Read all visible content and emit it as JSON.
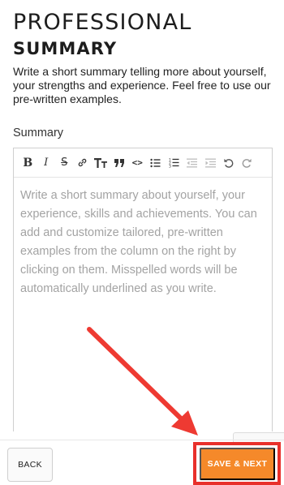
{
  "heading": {
    "line1": "PROFESSIONAL",
    "line2": "SUMMARY"
  },
  "description": "Write a short summary telling more about yourself, your strengths and experience. Feel free to use our pre-written examples.",
  "field": {
    "label": "Summary",
    "placeholder": "Write a short summary about yourself, your experience, skills and achievements. You can add and customize tailored, pre-written examples from the column on the right by clicking on them. Misspelled words will be automatically underlined as you write."
  },
  "toolbar": {
    "bold": "B",
    "italic": "I",
    "strike": "S",
    "code": "<>"
  },
  "footer": {
    "back_label": "BACK",
    "save_label": "SAVE & NEXT"
  },
  "colors": {
    "accent": "#f5892a",
    "highlight": "#e8302b",
    "placeholder": "#a3a3a3"
  }
}
